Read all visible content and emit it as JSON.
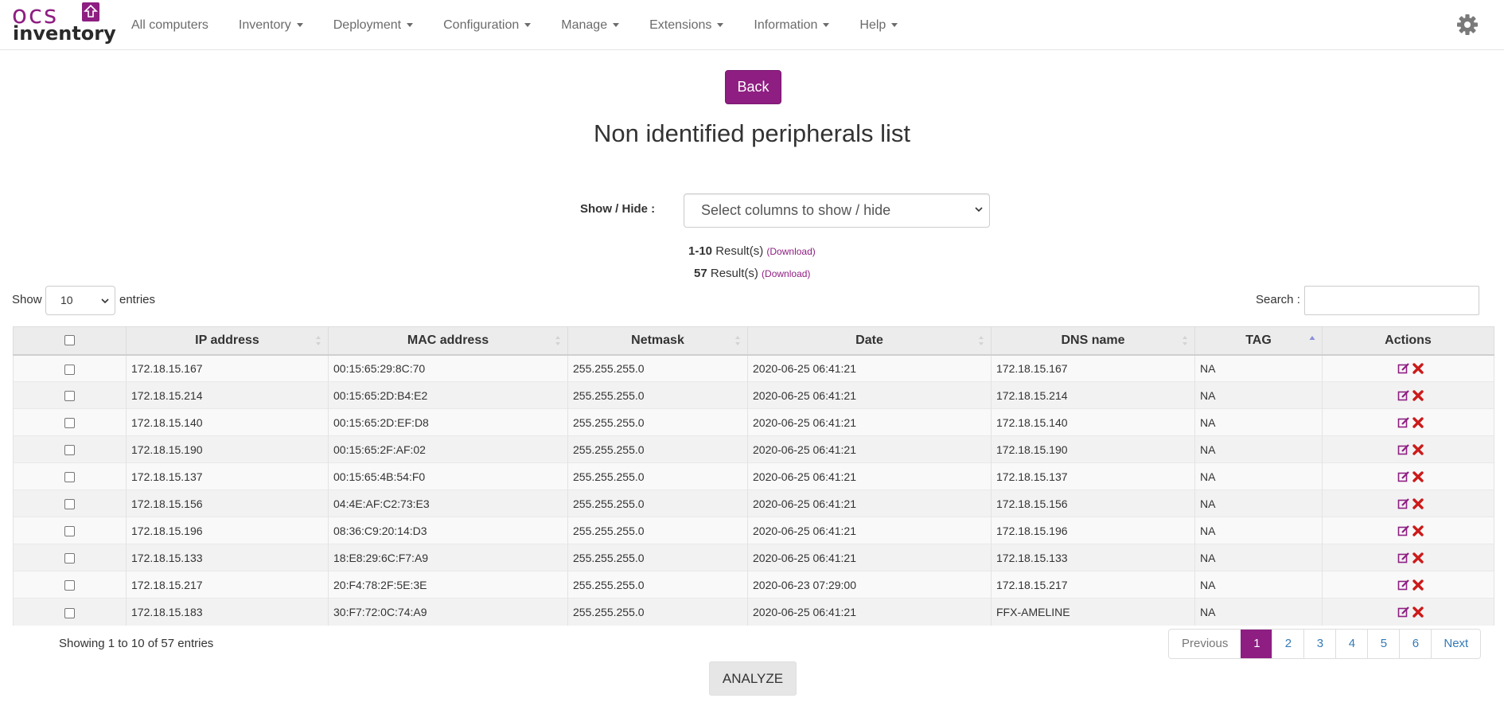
{
  "brand": {
    "logo_top": "ocs",
    "logo_bottom": "inventory",
    "accent": "#8e1e82"
  },
  "nav": {
    "items": [
      {
        "label": "All computers",
        "dropdown": false
      },
      {
        "label": "Inventory",
        "dropdown": true
      },
      {
        "label": "Deployment",
        "dropdown": true
      },
      {
        "label": "Configuration",
        "dropdown": true
      },
      {
        "label": "Manage",
        "dropdown": true
      },
      {
        "label": "Extensions",
        "dropdown": true
      },
      {
        "label": "Information",
        "dropdown": true
      },
      {
        "label": "Help",
        "dropdown": true
      }
    ],
    "settings_icon": "gear-icon"
  },
  "page": {
    "back_label": "Back",
    "title": "Non identified peripherals list",
    "show_hide_label": "Show / Hide :",
    "columns_select_placeholder": "Select columns to show / hide",
    "results": [
      {
        "range": "1-10",
        "suffix": "Result(s)",
        "download": "(Download)"
      },
      {
        "range": "57",
        "suffix": "Result(s)",
        "download": "(Download)"
      }
    ]
  },
  "controls": {
    "show_label": "Show",
    "page_length": "10",
    "entries_label": "entries",
    "search_label": "Search :",
    "search_value": ""
  },
  "table": {
    "columns": [
      "",
      "IP address",
      "MAC address",
      "Netmask",
      "Date",
      "DNS name",
      "TAG",
      "Actions"
    ],
    "sorted_column": "TAG",
    "rows": [
      [
        "172.18.15.167",
        "00:15:65:29:8C:70",
        "255.255.255.0",
        "2020-06-25 06:41:21",
        "172.18.15.167",
        "NA"
      ],
      [
        "172.18.15.214",
        "00:15:65:2D:B4:E2",
        "255.255.255.0",
        "2020-06-25 06:41:21",
        "172.18.15.214",
        "NA"
      ],
      [
        "172.18.15.140",
        "00:15:65:2D:EF:D8",
        "255.255.255.0",
        "2020-06-25 06:41:21",
        "172.18.15.140",
        "NA"
      ],
      [
        "172.18.15.190",
        "00:15:65:2F:AF:02",
        "255.255.255.0",
        "2020-06-25 06:41:21",
        "172.18.15.190",
        "NA"
      ],
      [
        "172.18.15.137",
        "00:15:65:4B:54:F0",
        "255.255.255.0",
        "2020-06-25 06:41:21",
        "172.18.15.137",
        "NA"
      ],
      [
        "172.18.15.156",
        "04:4E:AF:C2:73:E3",
        "255.255.255.0",
        "2020-06-25 06:41:21",
        "172.18.15.156",
        "NA"
      ],
      [
        "172.18.15.196",
        "08:36:C9:20:14:D3",
        "255.255.255.0",
        "2020-06-25 06:41:21",
        "172.18.15.196",
        "NA"
      ],
      [
        "172.18.15.133",
        "18:E8:29:6C:F7:A9",
        "255.255.255.0",
        "2020-06-25 06:41:21",
        "172.18.15.133",
        "NA"
      ],
      [
        "172.18.15.217",
        "20:F4:78:2F:5E:3E",
        "255.255.255.0",
        "2020-06-23 07:29:00",
        "172.18.15.217",
        "NA"
      ],
      [
        "172.18.15.183",
        "30:F7:72:0C:74:A9",
        "255.255.255.0",
        "2020-06-25 06:41:21",
        "FFX-AMELINE",
        "NA"
      ]
    ]
  },
  "footer": {
    "info": "Showing 1 to 10 of 57 entries",
    "previous": "Previous",
    "next": "Next",
    "pages": [
      "1",
      "2",
      "3",
      "4",
      "5",
      "6"
    ],
    "active_page": "1",
    "analyze_label": "ANALYZE"
  }
}
